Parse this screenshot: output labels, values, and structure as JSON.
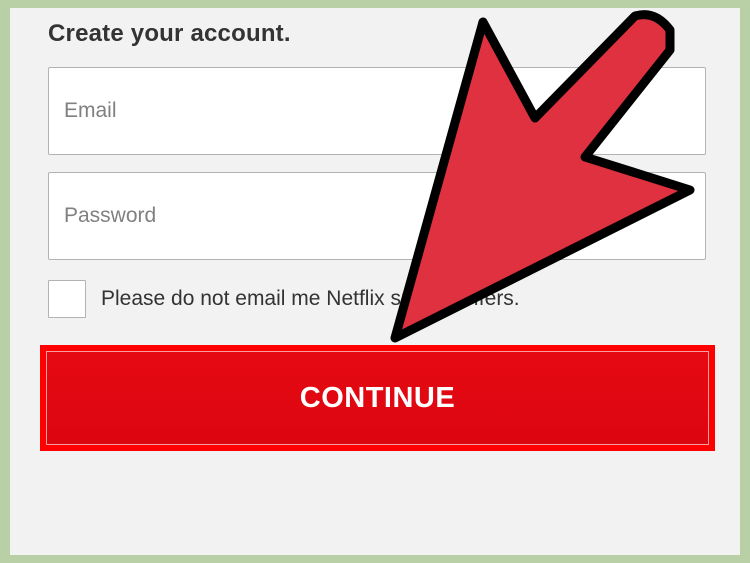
{
  "signup": {
    "title": "Create your account.",
    "email_placeholder": "Email",
    "password_placeholder": "Password",
    "email_value": "",
    "password_value": "",
    "checkbox_label": "Please do not email me Netflix special offers.",
    "checkbox_checked": false,
    "continue_label": "CONTINUE"
  },
  "colors": {
    "frame_border": "#b9cfa6",
    "panel_background": "#f2f2f2",
    "button_red": "#e50913",
    "highlight_red": "#ff0000",
    "arrow_fill": "#e03140",
    "arrow_outline": "#000000"
  },
  "annotation": {
    "icon": "pointer-arrow-icon",
    "target": "continue-button"
  }
}
